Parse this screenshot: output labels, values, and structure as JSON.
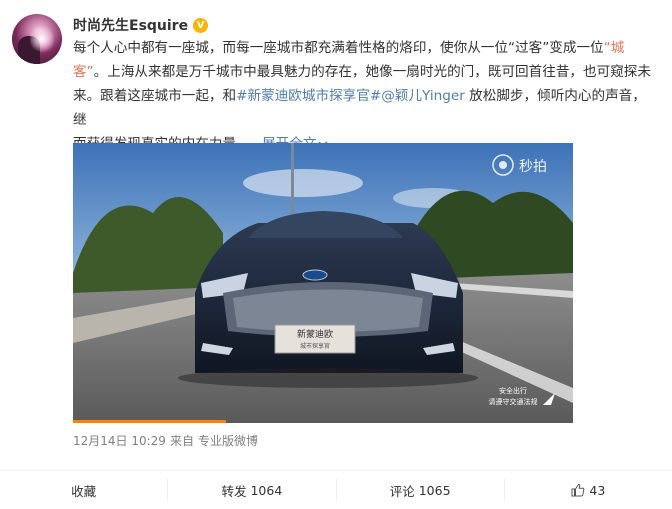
{
  "post": {
    "author": "时尚先生Esquire",
    "verified_icon": "verified-badge-icon",
    "text_line1_a": "每个人心中都有一座城，而每一座城市都充满着性格的烙印，使你从一位“过客”变成一位",
    "text_line1_b": "“城",
    "text_line2_a": "客”",
    "text_line2_b": "。上海从来都是万千城市中最具魅力的存在，她像一扇时光的门，既可回首往昔，也可窥探未",
    "text_line3_a": "来。跟着这座城市一起，和",
    "hashtag": "#新蒙迪欧城市探享官#",
    "mention": "@颖儿Yinger",
    "text_line3_b": " 放松脚步，倾听内心的声音，继",
    "text_line4_a": "而获得发现真实的内在力量，",
    "expand": "展开全文",
    "expand_icon": "chevron-down-icon",
    "media": {
      "watermark": "秒拍",
      "plate_line1": "新蒙迪欧",
      "plate_line2": "城市探享官",
      "safety_line1": "安全出行",
      "safety_line2": "请遵守交通法规"
    },
    "timestamp": "12月14日 10:29",
    "source_prefix": "来自",
    "source": "专业版微博"
  },
  "actions": {
    "favorite": "收藏",
    "repost_label": "转发",
    "repost_count": "1064",
    "comment_label": "评论",
    "comment_count": "1065",
    "like_count": "43"
  },
  "colors": {
    "link": "#eb7350",
    "topic": "#507daf",
    "verified": "#ffb300"
  }
}
